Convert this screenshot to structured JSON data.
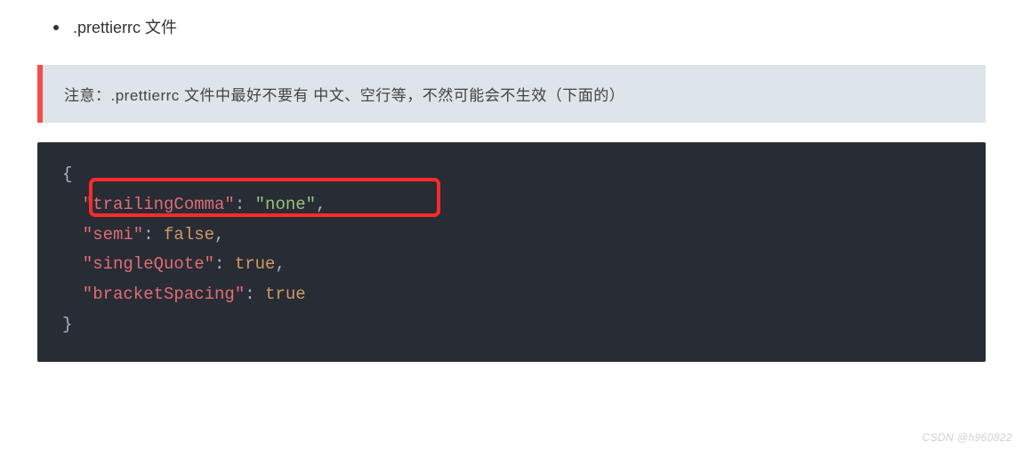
{
  "bullet": {
    "text": ".prettierrc 文件"
  },
  "callout": {
    "text": "注意：.prettierrc 文件中最好不要有 中文、空行等，不然可能会不生效（下面的）"
  },
  "code": {
    "open": "{",
    "close": "}",
    "lines": [
      {
        "key": "\"trailingComma\"",
        "colon": ": ",
        "value": "\"none\"",
        "valueClass": "tok-str",
        "trailing": ","
      },
      {
        "key": "\"semi\"",
        "colon": ": ",
        "value": "false",
        "valueClass": "tok-bool",
        "trailing": ","
      },
      {
        "key": "\"singleQuote\"",
        "colon": ": ",
        "value": "true",
        "valueClass": "tok-bool",
        "trailing": ","
      },
      {
        "key": "\"bracketSpacing\"",
        "colon": ": ",
        "value": "true",
        "valueClass": "tok-bool",
        "trailing": ""
      }
    ]
  },
  "highlight": {
    "left": "58",
    "top": "40",
    "width": "395",
    "height": "44"
  },
  "watermark": "CSDN @h960822"
}
